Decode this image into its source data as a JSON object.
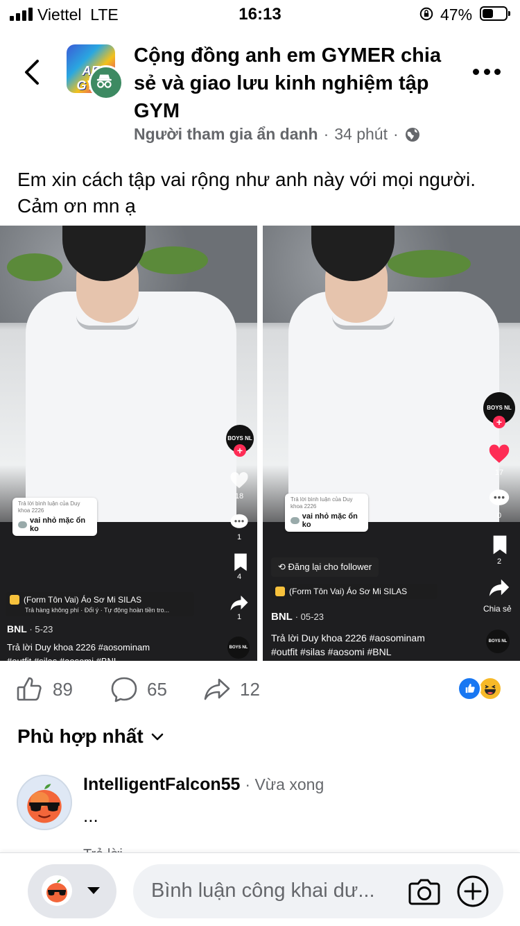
{
  "status_bar": {
    "carrier": "Viettel",
    "network": "LTE",
    "time": "16:13",
    "battery_percent": "47%",
    "battery_level": 0.47
  },
  "header": {
    "group_name": "Cộng đồng anh em GYMER chia sẻ và giao lưu kinh nghiệm tập GYM",
    "group_avatar_text": "AE GYM",
    "author": "Người tham gia ẩn danh",
    "separator": "·",
    "time_ago": "34 phút",
    "privacy_icon": "globe-icon"
  },
  "post": {
    "text": "Em xin cách tập vai rộng như anh này với mọi người. Cảm ơn mn ạ"
  },
  "photos": [
    {
      "brand": "BOYS NL",
      "counts": {
        "likes": "18",
        "comments": "1",
        "saves": "4",
        "shares": "1"
      },
      "reply_small": "Trả lời bình luận của Duy khoa 2226",
      "reply_main": "vai nhỏ mặc ổn ko",
      "shop_title": "(Form Tôn Vai) Áo Sơ Mi SILAS",
      "shop_sub": "Trả hàng không phí · Đổi ý · Tự động hoàn tiền tro...",
      "username": "BNL",
      "date": "· 5-23",
      "caption_line1": "Trả lời  Duy khoa 2226 #aosominam",
      "caption_line2": "#outfit #silas #aosomi #BNL"
    },
    {
      "brand": "BOYS NL",
      "counts": {
        "likes": "17",
        "comments": "0",
        "saves": "2"
      },
      "share_label": "Chia sẻ",
      "reply_small": "Trả lời bình luận của Duy khoa 2226",
      "reply_main": "vai nhỏ mặc ổn ko",
      "repost": "Đăng lại cho follower",
      "shop_title": "(Form Tôn Vai) Áo Sơ Mi SILAS",
      "username": "BNL",
      "date": "· 05-23",
      "caption_line1": "Trả lời  Duy khoa 2226 #aosominam",
      "caption_line2": "#outfit #silas #aosomi #BNL"
    }
  ],
  "actions": {
    "like_count": "89",
    "comment_count": "65",
    "share_count": "12",
    "reaction_icons": [
      "like-reaction-icon",
      "haha-reaction-icon"
    ]
  },
  "comments_section": {
    "sort_label": "Phù hợp nhất",
    "comment": {
      "author": "IntelligentFalcon55",
      "time": "· Vừa xong",
      "body": "...",
      "reply_peek": "Trả lời"
    }
  },
  "composer": {
    "placeholder": "Bình luận công khai dư..."
  },
  "colors": {
    "facebook_blue": "#1877f2",
    "anon_badge": "#3d8a62",
    "secondary_text": "#65676b",
    "tiktok_red": "#fe2c55"
  }
}
